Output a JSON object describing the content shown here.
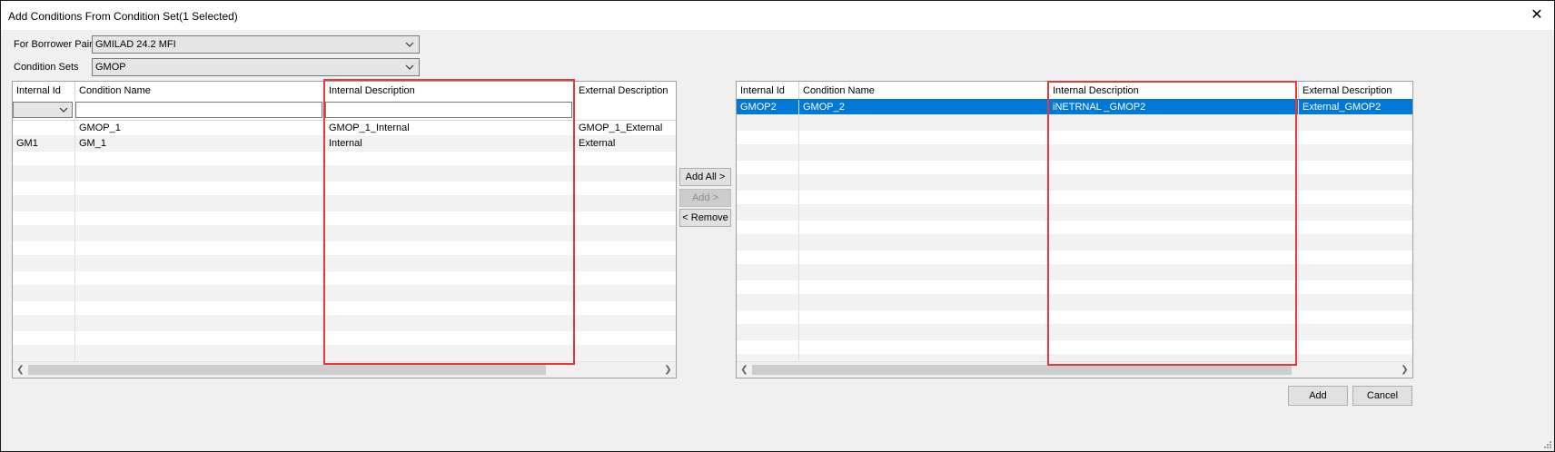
{
  "window": {
    "title": "Add Conditions From Condition Set(1 Selected)"
  },
  "form": {
    "borrower_pair_label": "For Borrower Pair",
    "borrower_pair_value": "GMILAD 24.2 MFI",
    "condition_sets_label": "Condition Sets",
    "condition_sets_value": "GMOP"
  },
  "left_grid": {
    "columns": [
      "Internal Id",
      "Condition Name",
      "Internal Description",
      "External Description"
    ],
    "rows": [
      {
        "internal_id": "",
        "condition_name": "GMOP_1",
        "internal_description": "GMOP_1_Internal",
        "external_description": "GMOP_1_External"
      },
      {
        "internal_id": "GM1",
        "condition_name": "GM_1",
        "internal_description": "Internal",
        "external_description": "External"
      }
    ]
  },
  "actions": {
    "add_all": "Add All >",
    "add": "Add >",
    "remove": "< Remove"
  },
  "right_grid": {
    "columns": [
      "Internal Id",
      "Condition Name",
      "Internal Description",
      "External Description"
    ],
    "rows": [
      {
        "internal_id": "GMOP2",
        "condition_name": "GMOP_2",
        "internal_description": "iNETRNAL _GMOP2",
        "external_description": "External_GMOP2",
        "selected": true
      }
    ]
  },
  "footer": {
    "add_label": "Add",
    "cancel_label": "Cancel"
  },
  "colors": {
    "selection": "#0078d7",
    "highlight_box": "#e8383d"
  },
  "icons": [
    "close-icon",
    "chevron-down-icon",
    "chevron-left-icon",
    "chevron-right-icon",
    "resize-grip-icon"
  ]
}
